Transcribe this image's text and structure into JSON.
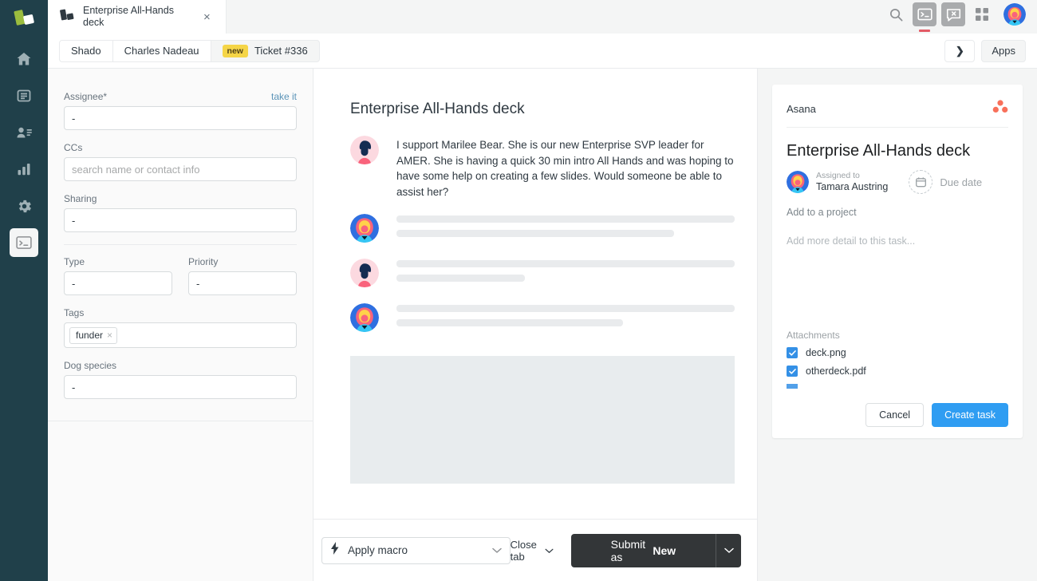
{
  "rail": {
    "logo_name": "zendesk-logo",
    "items": [
      {
        "name": "home",
        "icon": "home-icon",
        "active": false
      },
      {
        "name": "views",
        "icon": "views-icon",
        "active": false
      },
      {
        "name": "customers",
        "icon": "customers-icon",
        "active": false
      },
      {
        "name": "reporting",
        "icon": "reporting-icon",
        "active": false
      },
      {
        "name": "admin",
        "icon": "gear-icon",
        "active": false
      },
      {
        "name": "apps",
        "icon": "terminal-icon",
        "active": true
      }
    ]
  },
  "topbar": {
    "doc_tab_title": "Enterprise All-Hands deck",
    "close_label": "×",
    "actions": [
      {
        "name": "search-icon"
      },
      {
        "name": "terminal-icon"
      },
      {
        "name": "chat-dismiss-icon"
      },
      {
        "name": "grid-icon"
      }
    ]
  },
  "tabbar": {
    "crumbs": [
      "Shado",
      "Charles Nadeau"
    ],
    "ticket_badge": "new",
    "ticket_label": "Ticket #336",
    "next_label": "❯",
    "apps_label": "Apps"
  },
  "form": {
    "assignee": {
      "label": "Assignee*",
      "take_it": "take it",
      "value": "-"
    },
    "ccs": {
      "label": "CCs",
      "placeholder": "search name or contact info",
      "value": ""
    },
    "sharing": {
      "label": "Sharing",
      "value": "-"
    },
    "type": {
      "label": "Type",
      "value": "-"
    },
    "priority": {
      "label": "Priority",
      "value": "-"
    },
    "tags": {
      "label": "Tags",
      "chips": [
        {
          "text": "funder",
          "remove": "×"
        }
      ]
    },
    "dog_species": {
      "label": "Dog species",
      "value": "-"
    }
  },
  "conversation": {
    "title": "Enterprise All-Hands deck",
    "first_message": "I support Marilee Bear. She is our new Enterprise SVP leader for AMER. She is having a quick 30 min intro All Hands and was hoping to have some help on creating a few slides. Would someone be able to assist her?",
    "messages": [
      {
        "avatar": "dark-hair-avatar",
        "type": "text"
      },
      {
        "avatar": "blonde-avatar",
        "type": "skeleton",
        "lines": [
          100,
          82
        ]
      },
      {
        "avatar": "dark-hair-avatar",
        "type": "skeleton",
        "lines": [
          100,
          38
        ]
      },
      {
        "avatar": "blonde-avatar",
        "type": "skeleton",
        "lines": [
          100,
          67
        ]
      }
    ],
    "attachment_preview": "image-placeholder"
  },
  "composer": {
    "macro_label": "Apply macro",
    "macro_icon": "lightning-icon",
    "macro_caret": "⌄",
    "close_tab_label": "Close tab",
    "submit_prefix": "Submit as",
    "submit_state": "New"
  },
  "asana": {
    "app_name": "Asana",
    "logo_name": "asana-logo",
    "task_title": "Enterprise All-Hands deck",
    "assigned_label": "Assigned to",
    "assignee_name": "Tamara Austring",
    "due_date_label": "Due date",
    "due_date_icon": "calendar-icon",
    "add_project_label": "Add to a project",
    "detail_placeholder": "Add more detail to this task...",
    "attachments_label": "Attachments",
    "attachments": [
      {
        "name": "deck.png",
        "checked": true
      },
      {
        "name": "otherdeck.pdf",
        "checked": true
      }
    ],
    "cancel_label": "Cancel",
    "create_label": "Create task"
  },
  "colors": {
    "rail_bg": "#20404a",
    "accent_blue": "#2f9df2",
    "badge_yellow": "#f5d547",
    "asana_coral": "#f45d48",
    "submit_dark": "#333638",
    "indicator_red": "#e35b66"
  }
}
